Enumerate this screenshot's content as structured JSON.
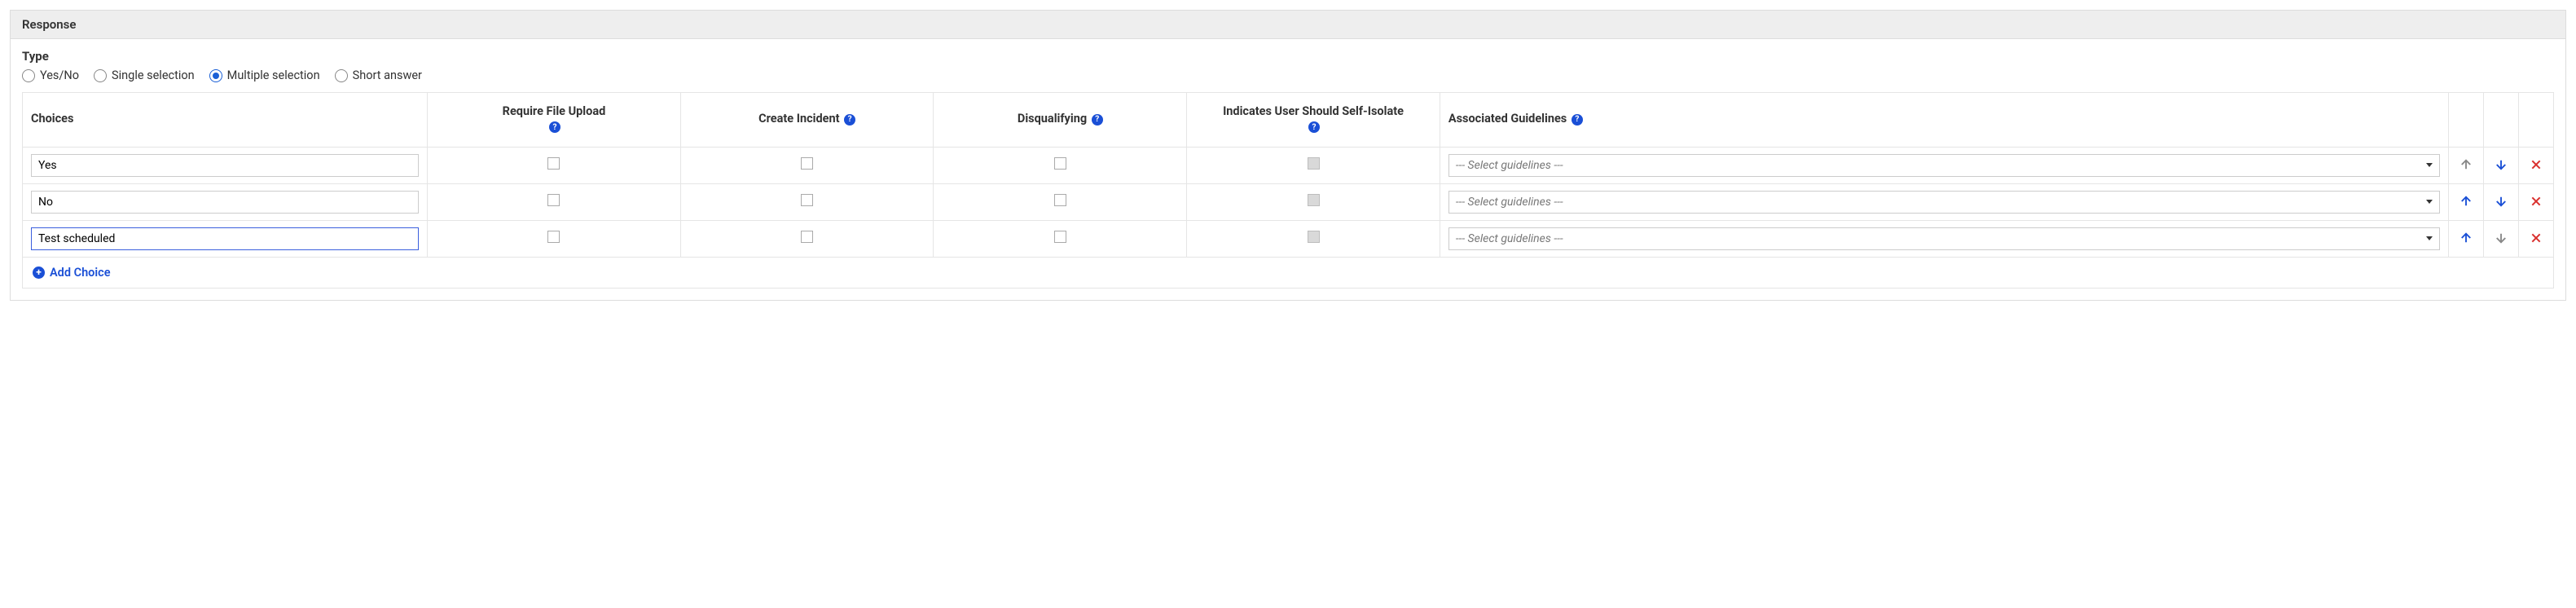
{
  "panel": {
    "title": "Response"
  },
  "type": {
    "label": "Type",
    "options": {
      "yesno": "Yes/No",
      "single": "Single selection",
      "multiple": "Multiple selection",
      "short": "Short answer"
    },
    "selected": "multiple"
  },
  "table": {
    "headers": {
      "choices": "Choices",
      "require_upload": "Require File Upload",
      "create_incident": "Create Incident",
      "disqualifying": "Disqualifying",
      "self_isolate": "Indicates User Should Self-Isolate",
      "guidelines": "Associated Guidelines"
    },
    "help_glyph": "?",
    "rows": [
      {
        "choice": "Yes",
        "require_upload": false,
        "create_incident": false,
        "disqualifying": false,
        "self_isolate_disabled": true,
        "guideline_placeholder": "--- Select guidelines ---",
        "up_enabled": false,
        "down_enabled": true,
        "focused": false
      },
      {
        "choice": "No",
        "require_upload": false,
        "create_incident": false,
        "disqualifying": false,
        "self_isolate_disabled": true,
        "guideline_placeholder": "--- Select guidelines ---",
        "up_enabled": true,
        "down_enabled": true,
        "focused": false
      },
      {
        "choice": "Test scheduled",
        "require_upload": false,
        "create_incident": false,
        "disqualifying": false,
        "self_isolate_disabled": true,
        "guideline_placeholder": "--- Select guidelines ---",
        "up_enabled": true,
        "down_enabled": false,
        "focused": true
      }
    ],
    "add_choice_label": "Add Choice"
  }
}
